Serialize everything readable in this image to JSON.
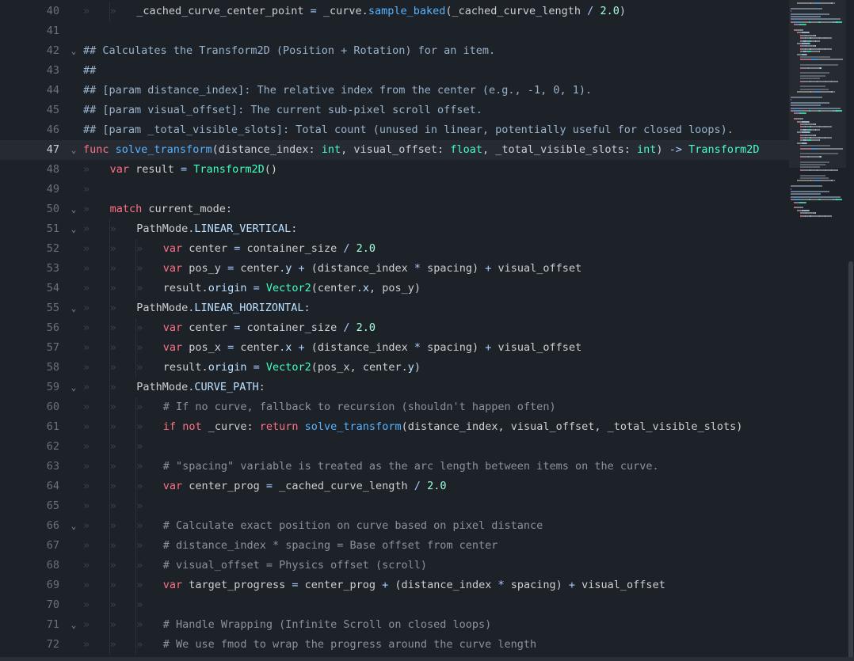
{
  "editor": {
    "lines": [
      {
        "n": "40",
        "fold": false,
        "indent": 2,
        "tokens": [
          [
            "pl",
            "_cached_curve_center_point "
          ],
          [
            "op",
            "="
          ],
          [
            "pl",
            " _curve."
          ],
          [
            "fn",
            "sample_baked"
          ],
          [
            "pl",
            "(_cached_curve_length "
          ],
          [
            "op",
            "/"
          ],
          [
            "pl",
            " "
          ],
          [
            "num",
            "2.0"
          ],
          [
            "pl",
            ")"
          ]
        ]
      },
      {
        "n": "41",
        "fold": false,
        "indent": 0,
        "tokens": []
      },
      {
        "n": "42",
        "fold": true,
        "indent": 0,
        "tokens": [
          [
            "dc",
            "## Calculates the Transform2D (Position + Rotation) for an item."
          ]
        ]
      },
      {
        "n": "43",
        "fold": false,
        "indent": 0,
        "tokens": [
          [
            "dc",
            "##"
          ]
        ]
      },
      {
        "n": "44",
        "fold": false,
        "indent": 0,
        "tokens": [
          [
            "dc",
            "## [param distance_index]: The relative index from the center (e.g., -1, 0, 1)."
          ]
        ]
      },
      {
        "n": "45",
        "fold": false,
        "indent": 0,
        "tokens": [
          [
            "dc",
            "## [param visual_offset]: The current sub-pixel scroll offset."
          ]
        ]
      },
      {
        "n": "46",
        "fold": false,
        "indent": 0,
        "tokens": [
          [
            "dc",
            "## [param _total_visible_slots]: Total count (unused in linear, potentially useful for closed loops)."
          ]
        ]
      },
      {
        "n": "47",
        "fold": true,
        "indent": 0,
        "current": true,
        "tokens": [
          [
            "kw",
            "func"
          ],
          [
            "pl",
            " "
          ],
          [
            "fn",
            "solve_transform"
          ],
          [
            "pl",
            "(distance_index: "
          ],
          [
            "ty",
            "int"
          ],
          [
            "pl",
            ", visual_offset: "
          ],
          [
            "ty",
            "float"
          ],
          [
            "pl",
            ", _total_visible_slots: "
          ],
          [
            "ty",
            "int"
          ],
          [
            "pl",
            ") "
          ],
          [
            "op",
            "->"
          ],
          [
            "pl",
            " "
          ],
          [
            "ty",
            "Transform2D"
          ]
        ]
      },
      {
        "n": "48",
        "fold": false,
        "indent": 1,
        "tokens": [
          [
            "kw",
            "var"
          ],
          [
            "pl",
            " result "
          ],
          [
            "op",
            "="
          ],
          [
            "pl",
            " "
          ],
          [
            "ty",
            "Transform2D"
          ],
          [
            "pl",
            "()"
          ]
        ]
      },
      {
        "n": "49",
        "fold": false,
        "indent": 1,
        "tokens": []
      },
      {
        "n": "50",
        "fold": true,
        "indent": 1,
        "tokens": [
          [
            "kw",
            "match"
          ],
          [
            "pl",
            " current_mode:"
          ]
        ]
      },
      {
        "n": "51",
        "fold": true,
        "indent": 2,
        "tokens": [
          [
            "pl",
            "PathMode."
          ],
          [
            "mem",
            "LINEAR_VERTICAL"
          ],
          [
            "pl",
            ":"
          ]
        ]
      },
      {
        "n": "52",
        "fold": false,
        "indent": 3,
        "tokens": [
          [
            "kw",
            "var"
          ],
          [
            "pl",
            " center "
          ],
          [
            "op",
            "="
          ],
          [
            "pl",
            " container_size "
          ],
          [
            "op",
            "/"
          ],
          [
            "pl",
            " "
          ],
          [
            "num",
            "2.0"
          ]
        ]
      },
      {
        "n": "53",
        "fold": false,
        "indent": 3,
        "tokens": [
          [
            "kw",
            "var"
          ],
          [
            "pl",
            " pos_y "
          ],
          [
            "op",
            "="
          ],
          [
            "pl",
            " center."
          ],
          [
            "mem",
            "y"
          ],
          [
            "pl",
            " "
          ],
          [
            "op",
            "+"
          ],
          [
            "pl",
            " (distance_index "
          ],
          [
            "op",
            "*"
          ],
          [
            "pl",
            " spacing) "
          ],
          [
            "op",
            "+"
          ],
          [
            "pl",
            " visual_offset"
          ]
        ]
      },
      {
        "n": "54",
        "fold": false,
        "indent": 3,
        "tokens": [
          [
            "pl",
            "result."
          ],
          [
            "mem",
            "origin"
          ],
          [
            "pl",
            " "
          ],
          [
            "op",
            "="
          ],
          [
            "pl",
            " "
          ],
          [
            "ty",
            "Vector2"
          ],
          [
            "pl",
            "(center."
          ],
          [
            "mem",
            "x"
          ],
          [
            "pl",
            ", pos_y)"
          ]
        ]
      },
      {
        "n": "55",
        "fold": true,
        "indent": 2,
        "tokens": [
          [
            "pl",
            "PathMode."
          ],
          [
            "mem",
            "LINEAR_HORIZONTAL"
          ],
          [
            "pl",
            ":"
          ]
        ]
      },
      {
        "n": "56",
        "fold": false,
        "indent": 3,
        "tokens": [
          [
            "kw",
            "var"
          ],
          [
            "pl",
            " center "
          ],
          [
            "op",
            "="
          ],
          [
            "pl",
            " container_size "
          ],
          [
            "op",
            "/"
          ],
          [
            "pl",
            " "
          ],
          [
            "num",
            "2.0"
          ]
        ]
      },
      {
        "n": "57",
        "fold": false,
        "indent": 3,
        "tokens": [
          [
            "kw",
            "var"
          ],
          [
            "pl",
            " pos_x "
          ],
          [
            "op",
            "="
          ],
          [
            "pl",
            " center."
          ],
          [
            "mem",
            "x"
          ],
          [
            "pl",
            " "
          ],
          [
            "op",
            "+"
          ],
          [
            "pl",
            " (distance_index "
          ],
          [
            "op",
            "*"
          ],
          [
            "pl",
            " spacing) "
          ],
          [
            "op",
            "+"
          ],
          [
            "pl",
            " visual_offset"
          ]
        ]
      },
      {
        "n": "58",
        "fold": false,
        "indent": 3,
        "tokens": [
          [
            "pl",
            "result."
          ],
          [
            "mem",
            "origin"
          ],
          [
            "pl",
            " "
          ],
          [
            "op",
            "="
          ],
          [
            "pl",
            " "
          ],
          [
            "ty",
            "Vector2"
          ],
          [
            "pl",
            "(pos_x, center."
          ],
          [
            "mem",
            "y"
          ],
          [
            "pl",
            ")"
          ]
        ]
      },
      {
        "n": "59",
        "fold": true,
        "indent": 2,
        "tokens": [
          [
            "pl",
            "PathMode."
          ],
          [
            "mem",
            "CURVE_PATH"
          ],
          [
            "pl",
            ":"
          ]
        ]
      },
      {
        "n": "60",
        "fold": false,
        "indent": 3,
        "tokens": [
          [
            "cm",
            "# If no curve, fallback to recursion (shouldn't happen often)"
          ]
        ]
      },
      {
        "n": "61",
        "fold": false,
        "indent": 3,
        "tokens": [
          [
            "kw",
            "if"
          ],
          [
            "pl",
            " "
          ],
          [
            "kw",
            "not"
          ],
          [
            "pl",
            " _curve: "
          ],
          [
            "kw",
            "return"
          ],
          [
            "pl",
            " "
          ],
          [
            "fn",
            "solve_transform"
          ],
          [
            "pl",
            "(distance_index, visual_offset, _total_visible_slots)"
          ]
        ]
      },
      {
        "n": "62",
        "fold": false,
        "indent": 3,
        "tokens": []
      },
      {
        "n": "63",
        "fold": false,
        "indent": 3,
        "tokens": [
          [
            "cm",
            "# \"spacing\" variable is treated as the arc length between items on the curve."
          ]
        ]
      },
      {
        "n": "64",
        "fold": false,
        "indent": 3,
        "tokens": [
          [
            "kw",
            "var"
          ],
          [
            "pl",
            " center_prog "
          ],
          [
            "op",
            "="
          ],
          [
            "pl",
            " _cached_curve_length "
          ],
          [
            "op",
            "/"
          ],
          [
            "pl",
            " "
          ],
          [
            "num",
            "2.0"
          ]
        ]
      },
      {
        "n": "65",
        "fold": false,
        "indent": 3,
        "tokens": []
      },
      {
        "n": "66",
        "fold": true,
        "indent": 3,
        "tokens": [
          [
            "cm",
            "# Calculate exact position on curve based on pixel distance"
          ]
        ]
      },
      {
        "n": "67",
        "fold": false,
        "indent": 3,
        "tokens": [
          [
            "cm",
            "# distance_index * spacing = Base offset from center"
          ]
        ]
      },
      {
        "n": "68",
        "fold": false,
        "indent": 3,
        "tokens": [
          [
            "cm",
            "# visual_offset = Physics offset (scroll)"
          ]
        ]
      },
      {
        "n": "69",
        "fold": false,
        "indent": 3,
        "tokens": [
          [
            "kw",
            "var"
          ],
          [
            "pl",
            " target_progress "
          ],
          [
            "op",
            "="
          ],
          [
            "pl",
            " center_prog "
          ],
          [
            "op",
            "+"
          ],
          [
            "pl",
            " (distance_index "
          ],
          [
            "op",
            "*"
          ],
          [
            "pl",
            " spacing) "
          ],
          [
            "op",
            "+"
          ],
          [
            "pl",
            " visual_offset"
          ]
        ]
      },
      {
        "n": "70",
        "fold": false,
        "indent": 3,
        "tokens": []
      },
      {
        "n": "71",
        "fold": true,
        "indent": 3,
        "tokens": [
          [
            "cm",
            "# Handle Wrapping (Infinite Scroll on closed loops)"
          ]
        ]
      },
      {
        "n": "72",
        "fold": false,
        "indent": 3,
        "tokens": [
          [
            "cm",
            "# We use fmod to wrap the progress around the curve length"
          ]
        ]
      }
    ],
    "tab_glyph": "»",
    "fold_glyph": "⌄",
    "colors": {
      "keyword": "#ff7085",
      "type": "#42ffc2",
      "function": "#57b3ff",
      "number": "#a1ffe0",
      "comment": "#8d9199",
      "background": "#1d2229"
    }
  }
}
